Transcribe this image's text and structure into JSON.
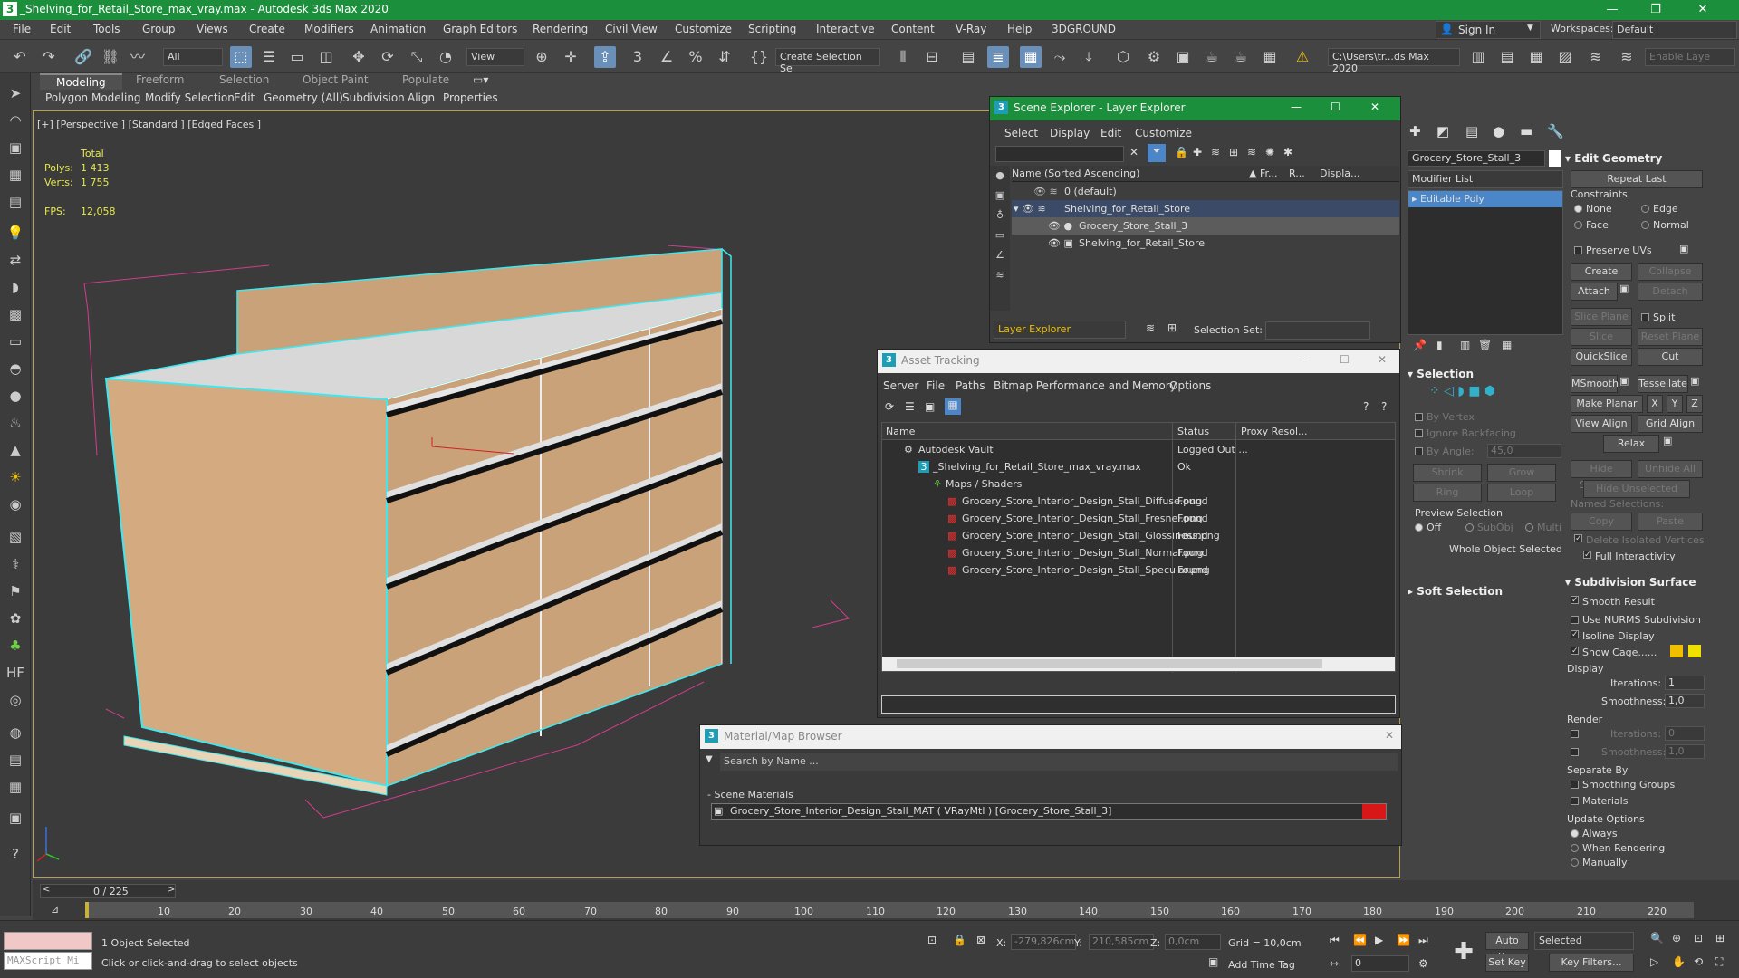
{
  "window": {
    "title": "_Shelving_for_Retail_Store_max_vray.max - Autodesk 3ds Max 2020",
    "minimize": "—",
    "maximize": "❐",
    "close": "✕"
  },
  "menu": {
    "items": [
      "File",
      "Edit",
      "Tools",
      "Group",
      "Views",
      "Create",
      "Modifiers",
      "Animation",
      "Graph Editors",
      "Rendering",
      "Civil View",
      "Customize",
      "Scripting",
      "Interactive",
      "Content",
      "V-Ray",
      "Help",
      "3DGROUND"
    ],
    "sign_in": "Sign In",
    "workspaces_label": "Workspaces:",
    "workspaces_value": "Default"
  },
  "toolbar": {
    "filter": "All",
    "ref_coord": "View",
    "selection_set": "Create Selection Se",
    "project_path": "C:\\Users\\tr...ds Max 2020",
    "enable_layer": "Enable Laye"
  },
  "ribbon": {
    "tabs": [
      "Modeling",
      "Freeform",
      "Selection",
      "Object Paint",
      "Populate"
    ],
    "subtabs": [
      "Polygon Modeling",
      "Modify Selection",
      "Edit",
      "Geometry (All)",
      "Subdivision",
      "Align",
      "Properties"
    ]
  },
  "viewport": {
    "label": "[+] [Perspective ] [Standard ] [Edged Faces ]",
    "stats": {
      "total_label": "Total",
      "polys_label": "Polys:",
      "polys_value": "1 413",
      "verts_label": "Verts:",
      "verts_value": "1 755",
      "fps_label": "FPS:",
      "fps_value": "12,058"
    }
  },
  "scene_explorer": {
    "title": "Scene Explorer - Layer Explorer",
    "menu": [
      "Select",
      "Display",
      "Edit",
      "Customize"
    ],
    "columns": [
      "Name (Sorted Ascending)",
      "▲ Fr...",
      "R...",
      "Displa..."
    ],
    "rows": [
      "0 (default)",
      "Shelving_for_Retail_Store",
      "Grocery_Store_Stall_3",
      "Shelving_for_Retail_Store"
    ],
    "explorer_dropdown": "Layer Explorer",
    "selection_set_label": "Selection Set:"
  },
  "asset_tracking": {
    "title": "Asset Tracking",
    "menu": [
      "Server",
      "File",
      "Paths",
      "Bitmap Performance and Memory",
      "Options"
    ],
    "columns": [
      "Name",
      "Status",
      "Proxy Resol..."
    ],
    "rows": [
      {
        "name": "Autodesk Vault",
        "status": "Logged Out ..."
      },
      {
        "name": "_Shelving_for_Retail_Store_max_vray.max",
        "status": "Ok"
      },
      {
        "name": "Maps / Shaders",
        "status": ""
      },
      {
        "name": "Grocery_Store_Interior_Design_Stall_Diffuse.png",
        "status": "Found"
      },
      {
        "name": "Grocery_Store_Interior_Design_Stall_Fresnel.png",
        "status": "Found"
      },
      {
        "name": "Grocery_Store_Interior_Design_Stall_Glossiness.png",
        "status": "Found"
      },
      {
        "name": "Grocery_Store_Interior_Design_Stall_Normal.png",
        "status": "Found"
      },
      {
        "name": "Grocery_Store_Interior_Design_Stall_Specular.png",
        "status": "Found"
      }
    ]
  },
  "material_browser": {
    "title": "Material/Map Browser",
    "search_placeholder": "Search by Name ...",
    "group": "- Scene Materials",
    "item": "Grocery_Store_Interior_Design_Stall_MAT ( VRayMtl ) [Grocery_Store_Stall_3]"
  },
  "command_panel": {
    "object_name": "Grocery_Store_Stall_3",
    "modifier_list": "Modifier List",
    "modifier_item": "Editable Poly",
    "selection_title": "Selection",
    "by_vertex": "By Vertex",
    "ignore_backfacing": "Ignore Backfacing",
    "by_angle": "By Angle:",
    "by_angle_value": "45,0",
    "shrink": "Shrink",
    "grow": "Grow",
    "ring": "Ring",
    "loop": "Loop",
    "preview_selection": "Preview Selection",
    "preview_off": "Off",
    "preview_subobj": "SubObj",
    "preview_multi": "Multi",
    "whole_object_selected": "Whole Object Selected",
    "soft_selection": "Soft Selection",
    "edit_geometry": "Edit Geometry",
    "repeat_last": "Repeat Last",
    "constraints": "Constraints",
    "c_none": "None",
    "c_edge": "Edge",
    "c_face": "Face",
    "c_normal": "Normal",
    "preserve_uvs": "Preserve UVs",
    "create": "Create",
    "collapse": "Collapse",
    "attach": "Attach",
    "detach": "Detach",
    "slice_plane": "Slice Plane",
    "split": "Split",
    "slice": "Slice",
    "reset_plane": "Reset Plane",
    "quickslice": "QuickSlice",
    "cut": "Cut",
    "msmooth": "MSmooth",
    "tessellate": "Tessellate",
    "make_planar": "Make Planar",
    "x": "X",
    "y": "Y",
    "z": "Z",
    "view_align": "View Align",
    "grid_align": "Grid Align",
    "relax": "Relax",
    "hide_selected": "Hide Selected",
    "unhide_all": "Unhide All",
    "hide_unselected": "Hide Unselected",
    "named_selections": "Named Selections:",
    "copy": "Copy",
    "paste": "Paste",
    "delete_isolated": "Delete Isolated Vertices",
    "full_interactivity": "Full Interactivity",
    "subdivision_surface": "Subdivision Surface",
    "smooth_result": "Smooth Result",
    "use_nurms": "Use NURMS Subdivision",
    "isoline_display": "Isoline Display",
    "show_cage": "Show Cage......",
    "display": "Display",
    "iterations": "Iterations:",
    "iterations_value": "1",
    "smoothness": "Smoothness:",
    "smoothness_value": "1,0",
    "render": "Render",
    "r_iterations": "Iterations:",
    "r_iterations_value": "0",
    "r_smoothness": "Smoothness:",
    "r_smoothness_value": "1,0",
    "separate_by": "Separate By",
    "smoothing_groups": "Smoothing Groups",
    "materials": "Materials",
    "update_options": "Update Options",
    "always": "Always",
    "when_rendering": "When Rendering",
    "manually": "Manually"
  },
  "timeline": {
    "frame": "0 / 225",
    "ticks": [
      "10",
      "20",
      "30",
      "40",
      "50",
      "60",
      "70",
      "80",
      "90",
      "100",
      "110",
      "120",
      "130",
      "140",
      "150",
      "160",
      "170",
      "180",
      "190",
      "200",
      "210",
      "220"
    ]
  },
  "status": {
    "maxscript": "MAXScript Mi",
    "selected": "1 Object Selected",
    "prompt": "Click or click-and-drag to select objects",
    "x_label": "X:",
    "x_value": "-279,826cm",
    "y_label": "Y:",
    "y_value": "210,585cm",
    "z_label": "Z:",
    "z_value": "0,0cm",
    "grid": "Grid = 10,0cm",
    "add_time_tag": "Add Time Tag",
    "auto_key": "Auto Key",
    "selected_dd": "Selected",
    "set_key": "Set Key",
    "key_filters": "Key Filters...",
    "frame_value": "0"
  },
  "colors": {
    "title_green": "#1c8f3c",
    "selection_cyan": "#3ee8f0",
    "wood": "#c9a27a",
    "shelf": "#d8d8d8",
    "cage_pink": "#d23c8c",
    "show_cage_yellow": "#f0c000"
  }
}
